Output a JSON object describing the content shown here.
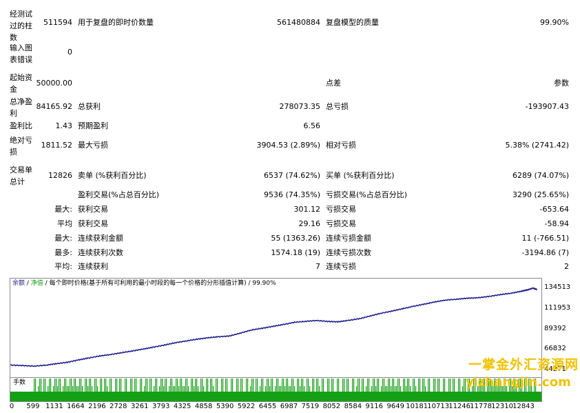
{
  "stats": {
    "bars_label": "经测试过的柱数",
    "bars_value": "511594",
    "ticks_label": "用于复盘的即时价数量",
    "ticks_value": "561480884",
    "quality_label": "复盘模型的质量",
    "quality_value": "99.90%",
    "mismatch_label": "输入图表错误",
    "mismatch_value": "0",
    "deposit_label": "起始资金",
    "deposit_value": "50000.00",
    "spread_label": "点差",
    "spread_value": "参数",
    "net_label": "总净盈利",
    "net_value": "84165.92",
    "gross_profit_label": "总获利",
    "gross_profit_value": "278073.35",
    "gross_loss_label": "总亏损",
    "gross_loss_value": "-193907.43",
    "pf_label": "盈利比",
    "pf_value": "1.43",
    "expected_label": "预期盈利",
    "expected_value": "6.56",
    "abs_dd_label": "绝对亏损",
    "abs_dd_value": "1811.52",
    "max_dd_label": "最大亏损",
    "max_dd_value": "3904.53 (2.89%)",
    "rel_dd_label": "相对亏损",
    "rel_dd_value": "5.38% (2741.42)",
    "trades_label": "交易单总计",
    "trades_value": "12826",
    "short_label": "卖单 (%获利百分比)",
    "short_value": "6537 (74.62%)",
    "long_label": "买单 (%获利百分比)",
    "long_value": "6289 (74.07%)",
    "profit_trades_label": "盈利交易(%占总百分比)",
    "profit_trades_value": "9536 (74.35%)",
    "loss_trades_label": "亏损交易(%占总百分比)",
    "loss_trades_value": "3290 (25.65%)",
    "max_prefix": "最大:",
    "largest_profit_label": "获利交易",
    "largest_profit_value": "301.12",
    "largest_loss_label": "亏损交易",
    "largest_loss_value": "-653.64",
    "avg_prefix": "平均",
    "avg_profit_label": "获利交易",
    "avg_profit_value": "29.16",
    "avg_loss_label": "亏损交易",
    "avg_loss_value": "-58.94",
    "max2_prefix": "最大:",
    "cons_wins_amt_label": "连续获利金额",
    "cons_wins_amt_value": "55 (1363.26)",
    "cons_loss_amt_label": "连续亏损金额",
    "cons_loss_amt_value": "11 (-766.51)",
    "most_prefix": "最多:",
    "cons_wins_cnt_label": "连续获利次数",
    "cons_wins_cnt_value": "1574.18 (19)",
    "cons_loss_cnt_label": "连续亏损次数",
    "cons_loss_cnt_value": "-3194.86 (7)",
    "avg2_prefix": "平均:",
    "avg_cons_win_label": "连续获利",
    "avg_cons_win_value": "7",
    "avg_cons_loss_label": "连续亏损",
    "avg_cons_loss_value": "2"
  },
  "chart_header": {
    "balance": "余额",
    "sep1": " / ",
    "equity": "净值",
    "sep2": " / ",
    "desc": "每个即时价格(基于所有可利用的最小时段的每一个价格的分形插值计算)",
    "sep3": " / ",
    "quality": "99.90%"
  },
  "volume_label": "手数",
  "watermark": {
    "line1": "一掌金外汇资源网",
    "line2": "yizhangjin.com"
  },
  "colors": {
    "balance_line": "#1f1f8f",
    "volume_bar": "#14a014"
  },
  "chart_data": {
    "type": "line",
    "title": "",
    "xlabel": "",
    "ylabel": "",
    "x_ticks": [
      "0",
      "599",
      "1131",
      "1664",
      "2196",
      "2728",
      "3261",
      "3793",
      "4325",
      "4858",
      "5390",
      "5922",
      "6455",
      "6987",
      "7519",
      "8052",
      "8584",
      "9116",
      "9649",
      "10181",
      "10713",
      "11246",
      "11778",
      "12310",
      "12843"
    ],
    "y_ticks": [
      "134513",
      "111953",
      "89392",
      "66832",
      "44271"
    ],
    "ylim": [
      44271,
      134513
    ],
    "xlim": [
      0,
      12843
    ],
    "series": [
      {
        "name": "余额",
        "x": [
          0,
          300,
          599,
          900,
          1131,
          1400,
          1664,
          1900,
          2196,
          2450,
          2728,
          3000,
          3261,
          3500,
          3793,
          4050,
          4325,
          4600,
          4858,
          5100,
          5390,
          5650,
          5922,
          6200,
          6455,
          6700,
          6987,
          7250,
          7519,
          7800,
          8052,
          8300,
          8584,
          8850,
          9116,
          9400,
          9649,
          9900,
          10181,
          10450,
          10713,
          11000,
          11246,
          11500,
          11778,
          12050,
          12310,
          12550,
          12700,
          12843,
          12950
        ],
        "y": [
          50000,
          49400,
          48800,
          50000,
          51500,
          53000,
          55500,
          57500,
          60000,
          61500,
          63500,
          65500,
          67500,
          69500,
          72000,
          74500,
          76500,
          78500,
          80000,
          81000,
          82000,
          85000,
          88500,
          90500,
          92500,
          94500,
          97000,
          98000,
          99000,
          98000,
          97500,
          99000,
          101000,
          104000,
          107000,
          109500,
          112000,
          114500,
          117000,
          119500,
          121500,
          122500,
          123500,
          124000,
          125500,
          127500,
          129000,
          131000,
          132500,
          134500,
          133000
        ]
      }
    ],
    "volume_series": {
      "name": "手数",
      "pattern": "dense"
    }
  }
}
